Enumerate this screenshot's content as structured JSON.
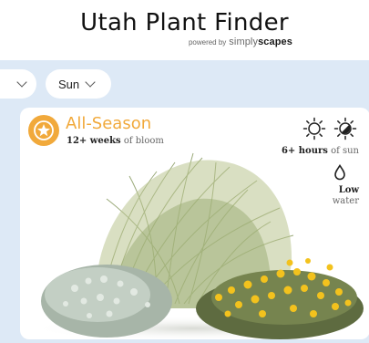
{
  "header": {
    "title": "Utah Plant Finder",
    "powered_by": "powered by",
    "brand_part1": "simply",
    "brand_part2": "scapes"
  },
  "filters": {
    "partial_label": "",
    "sun_label": "Sun"
  },
  "card": {
    "season_title": "All-Season",
    "bloom_value": "12+ weeks",
    "bloom_suffix": "of bloom",
    "sun_value": "6+ hours",
    "sun_suffix": "of sun",
    "water_amount": "Low",
    "water_label": "water",
    "icons": [
      "star-flower-icon",
      "full-sun-icon",
      "partial-sun-icon",
      "water-drop-icon"
    ],
    "colors": {
      "accent": "#f1a93b",
      "band": "#dde9f6"
    }
  }
}
